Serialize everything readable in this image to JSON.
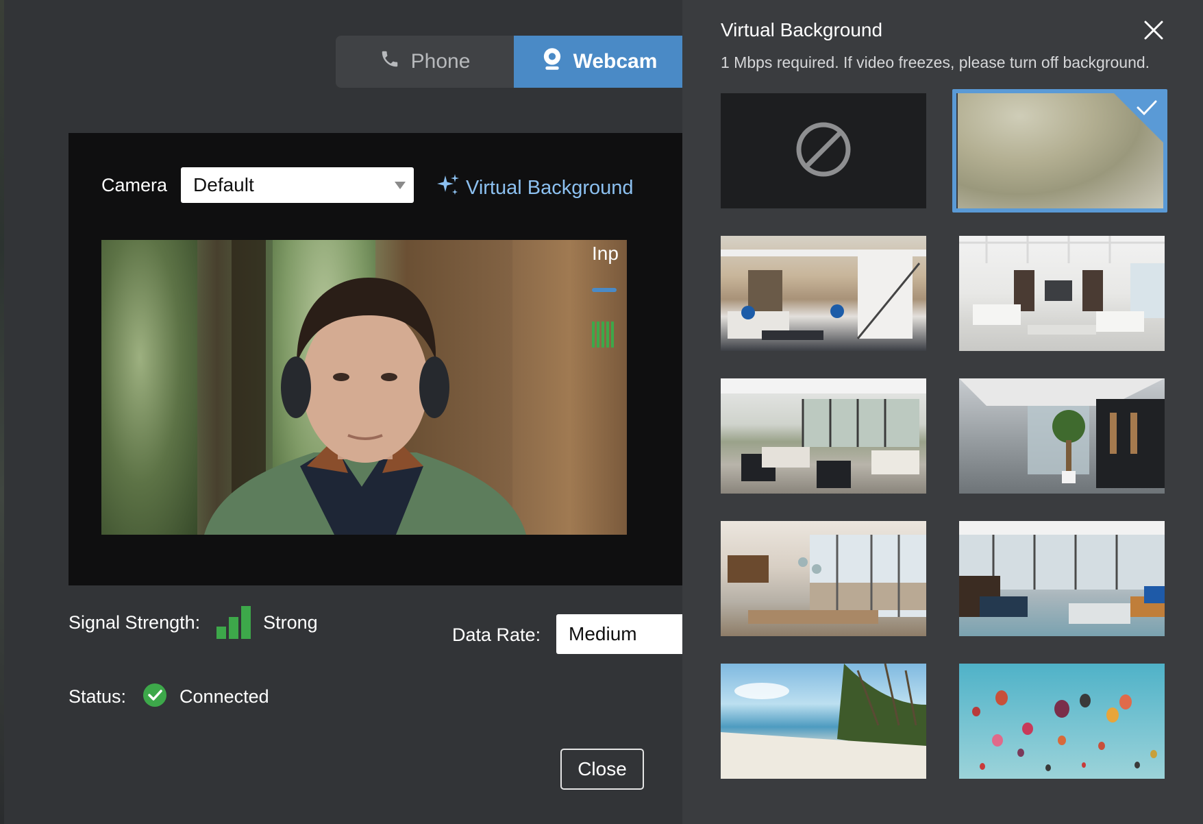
{
  "tabs": {
    "phone_label": "Phone",
    "webcam_label": "Webcam",
    "active": "Webcam"
  },
  "camera": {
    "label": "Camera",
    "selected": "Default"
  },
  "virtual_background_link": "Virtual Background",
  "input": {
    "label": "Inp"
  },
  "signal": {
    "label": "Signal Strength:",
    "value": "Strong"
  },
  "data_rate": {
    "label": "Data Rate:",
    "selected": "Medium"
  },
  "status": {
    "label": "Status:",
    "value": "Connected"
  },
  "close_button": "Close",
  "panel": {
    "title": "Virtual Background",
    "subtitle": "1 Mbps required. If video freezes, please turn off background.",
    "selected_index": 1,
    "backgrounds": [
      "none",
      "blur",
      "living-room",
      "white-living-room",
      "modern-lounge",
      "office-lobby",
      "dining-room-view",
      "office-lounge",
      "beach",
      "hot-air-balloons"
    ]
  },
  "colors": {
    "accent": "#4a8ac6",
    "link": "#8cc0f0",
    "success": "#3da84a",
    "panel_bg": "#3a3c3f",
    "dialog_bg": "#323437"
  }
}
